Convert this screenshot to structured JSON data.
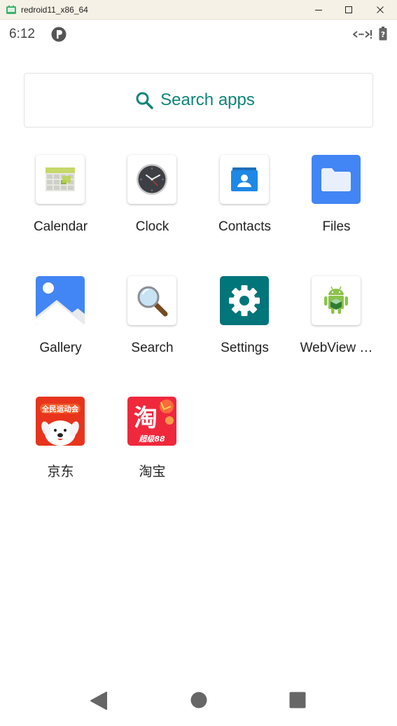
{
  "window": {
    "title": "redroid11_x86_64"
  },
  "status_bar": {
    "time": "6:12",
    "icons": [
      "notification-p-icon",
      "network-data-icon",
      "battery-unknown-icon"
    ]
  },
  "search": {
    "label": "Search apps",
    "accent_color": "#0f847a"
  },
  "apps": [
    {
      "label": "Calendar",
      "icon": "calendar-icon"
    },
    {
      "label": "Clock",
      "icon": "clock-icon"
    },
    {
      "label": "Contacts",
      "icon": "contacts-icon"
    },
    {
      "label": "Files",
      "icon": "files-icon"
    },
    {
      "label": "Gallery",
      "icon": "gallery-icon"
    },
    {
      "label": "Search",
      "icon": "magnifier-icon"
    },
    {
      "label": "Settings",
      "icon": "settings-gear-icon"
    },
    {
      "label": "WebView …",
      "icon": "webview-android-icon"
    },
    {
      "label": "京东",
      "icon": "jd-icon"
    },
    {
      "label": "淘宝",
      "icon": "taobao-icon"
    }
  ],
  "app_icon_text": {
    "jd_banner": "全民运动会",
    "taobao_char": "淘",
    "taobao_banner": "超级88"
  },
  "nav_bar": {
    "buttons": [
      "back-icon",
      "home-icon",
      "recents-icon"
    ]
  }
}
